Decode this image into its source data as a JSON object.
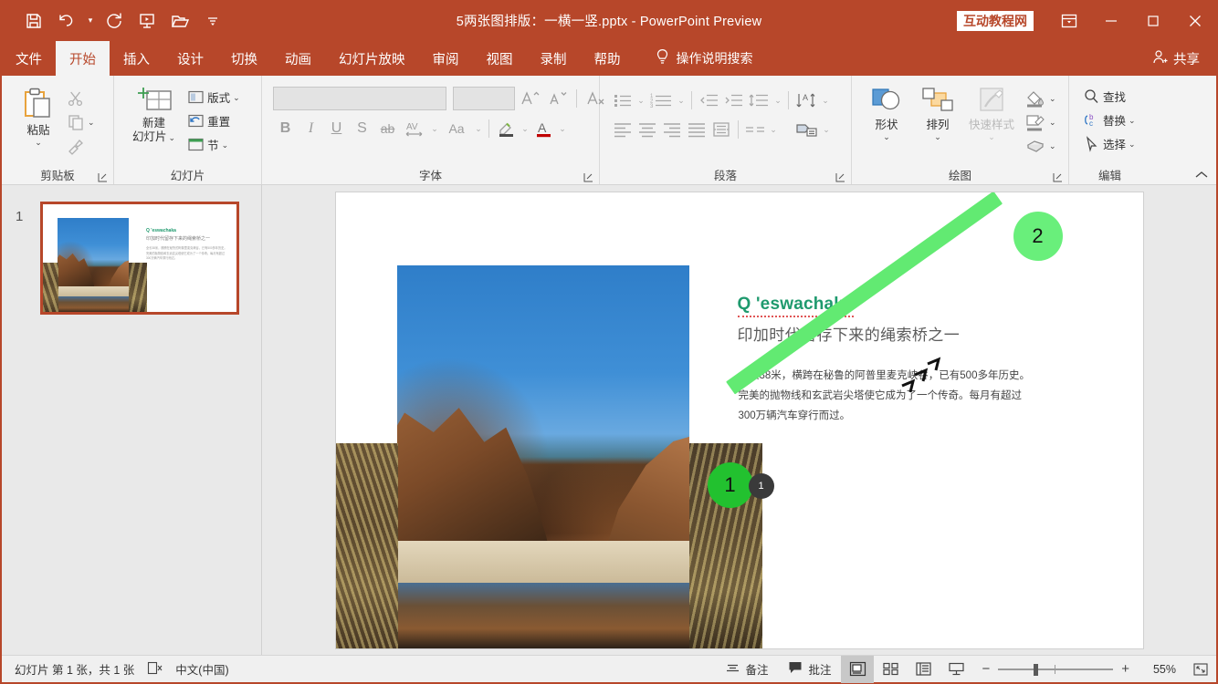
{
  "titlebar": {
    "title": "5两张图排版：一横一竖.pptx  -  PowerPoint Preview",
    "brand_badge": "互动教程网",
    "qat": [
      {
        "name": "save",
        "icon": "save-icon"
      },
      {
        "name": "undo",
        "icon": "undo-icon"
      },
      {
        "name": "redo",
        "icon": "redo-icon"
      },
      {
        "name": "start-slideshow",
        "icon": "slideshow-icon"
      },
      {
        "name": "open",
        "icon": "folder-open-icon"
      },
      {
        "name": "customize-qat",
        "icon": "chevron-down-icon"
      }
    ],
    "window_buttons": [
      {
        "name": "ribbon-display-options",
        "icon": "ribbon-options-icon"
      },
      {
        "name": "minimize",
        "icon": "minimize-icon"
      },
      {
        "name": "maximize",
        "icon": "maximize-icon"
      },
      {
        "name": "close",
        "icon": "close-icon"
      }
    ]
  },
  "tabs": [
    {
      "label": "文件",
      "active": false
    },
    {
      "label": "开始",
      "active": true
    },
    {
      "label": "插入",
      "active": false
    },
    {
      "label": "设计",
      "active": false
    },
    {
      "label": "切换",
      "active": false
    },
    {
      "label": "动画",
      "active": false
    },
    {
      "label": "幻灯片放映",
      "active": false
    },
    {
      "label": "审阅",
      "active": false
    },
    {
      "label": "视图",
      "active": false
    },
    {
      "label": "录制",
      "active": false
    },
    {
      "label": "帮助",
      "active": false
    }
  ],
  "tellme": {
    "label": "操作说明搜索"
  },
  "share": {
    "label": "共享"
  },
  "ribbon": {
    "groups": {
      "clipboard": {
        "label": "剪贴板",
        "paste": "粘贴",
        "cut": "剪切",
        "copy": "复制",
        "format_painter": "格式刷"
      },
      "slides": {
        "label": "幻灯片",
        "new_slide": "新建\n幻灯片",
        "new_slide_l1": "新建",
        "new_slide_l2": "幻灯片",
        "layout": "版式",
        "reset": "重置",
        "section": "节"
      },
      "font": {
        "label": "字体",
        "font_name_value": "",
        "font_size_value": "",
        "grow": "A",
        "shrink": "A",
        "clear_format": "清除所有格式",
        "bold": "B",
        "italic": "I",
        "underline": "U",
        "shadow": "S",
        "strikethrough": "ab",
        "char_spacing": "AV",
        "change_case": "Aa",
        "highlight": "文本突出显示颜色",
        "font_color": "A"
      },
      "paragraph": {
        "label": "段落",
        "bullets": "项目符号",
        "numbering": "编号",
        "decrease_indent": "减少缩进量",
        "increase_indent": "增加缩进量",
        "line_spacing": "行距",
        "align_left": "左对齐",
        "align_center": "居中",
        "align_right": "右对齐",
        "justify": "两端对齐",
        "distribute": "分散对齐",
        "columns": "分栏",
        "text_direction": "文字方向",
        "align_text": "对齐文本",
        "smartart": "转换为 SmartArt"
      },
      "drawing": {
        "label": "绘图",
        "shapes": "形状",
        "arrange": "排列",
        "quick_styles": "快速样式",
        "shape_fill": "形状填充",
        "shape_outline": "形状轮廓",
        "shape_effects": "形状效果"
      },
      "editing": {
        "label": "编辑",
        "find": "查找",
        "replace": "替换",
        "select": "选择"
      }
    }
  },
  "slide_panel": {
    "slides": [
      {
        "number": "1",
        "selected": true
      }
    ]
  },
  "slide": {
    "title": "Q 'eswachaka",
    "subtitle": "印加时代留存下来的绳索桥之一",
    "body_lines": [
      "全长38米，横跨在秘鲁的阿普里麦克峡谷，已有500多年历史。",
      "完美的抛物线和玄武岩尖塔使它成为了一个传奇。每月有超过",
      "300万辆汽车穿行而过。"
    ],
    "colors": {
      "title": "#1f9a6e",
      "subtitle": "#5b5b5b",
      "body": "#444444"
    }
  },
  "annotations": {
    "marker1": "1",
    "marker2": "2",
    "badge1": "1",
    "color_dark": "#22c12f",
    "color_light": "#69ef7b"
  },
  "status": {
    "slide_count": "幻灯片 第 1 张，共 1 张",
    "accessibility_icon": "accessibility-check-icon",
    "language": "中文(中国)",
    "notes": "备注",
    "comments": "批注",
    "views": [
      {
        "name": "normal-view",
        "active": true
      },
      {
        "name": "slide-sorter-view",
        "active": false
      },
      {
        "name": "reading-view",
        "active": false
      },
      {
        "name": "slideshow-view",
        "active": false
      }
    ],
    "zoom_out": "−",
    "zoom_in": "+",
    "zoom_level": "55%",
    "fit_to_window": "使幻灯片适应当前窗口"
  }
}
